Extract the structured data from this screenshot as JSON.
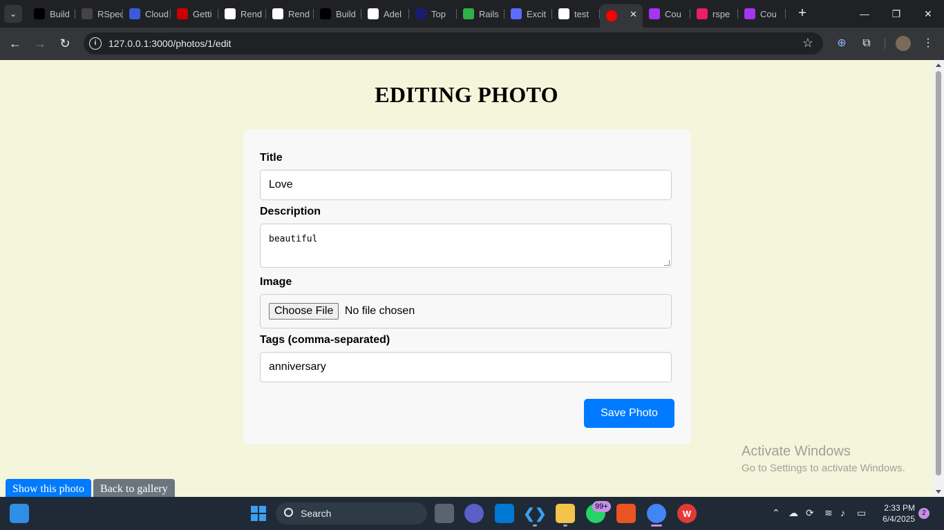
{
  "browser": {
    "tabs": [
      {
        "label": "Build",
        "icon": "medium-icon",
        "color": "#000000"
      },
      {
        "label": "RSpec",
        "icon": "rspec-icon",
        "color": "#444444"
      },
      {
        "label": "Cloud",
        "icon": "cloud-icon",
        "color": "#3b5bdb"
      },
      {
        "label": "Getti",
        "icon": "rails-guide-icon",
        "color": "#cc0000"
      },
      {
        "label": "Rend",
        "icon": "render-icon",
        "color": "#ffffff"
      },
      {
        "label": "Rend",
        "icon": "render-icon",
        "color": "#ffffff"
      },
      {
        "label": "Build",
        "icon": "medium-icon",
        "color": "#000000"
      },
      {
        "label": "Adel",
        "icon": "github-icon",
        "color": "#ffffff"
      },
      {
        "label": "Top",
        "icon": "b4a-icon",
        "color": "#1a1a6e"
      },
      {
        "label": "Rails",
        "icon": "rails-icon",
        "color": "#2db24a"
      },
      {
        "label": "Excit",
        "icon": "gear-icon",
        "color": "#5b6cff"
      },
      {
        "label": "test",
        "icon": "google-icon",
        "color": "#ffffff"
      },
      {
        "label": "",
        "icon": "red-dot-icon",
        "color": "#ff0000",
        "active": true
      },
      {
        "label": "Cou",
        "icon": "udemy-icon",
        "color": "#a435f0"
      },
      {
        "label": "rspe",
        "icon": "heart-icon",
        "color": "#e91e63"
      },
      {
        "label": "Cou",
        "icon": "udemy-icon",
        "color": "#a435f0"
      }
    ],
    "url_host": "127.0.0.1",
    "url_path": ":3000/photos/1/edit"
  },
  "page": {
    "title": "EDITING PHOTO",
    "form": {
      "title_label": "Title",
      "title_value": "Love",
      "description_label": "Description",
      "description_value": "beautiful",
      "image_label": "Image",
      "file_button": "Choose File",
      "file_status": "No file chosen",
      "tags_label": "Tags (comma-separated)",
      "tags_value": "anniversary",
      "submit_label": "Save Photo"
    },
    "show_link": "Show this photo",
    "back_link": "Back to gallery",
    "accent_color": "#007bff",
    "background_color": "#f5f5dc"
  },
  "watermark": {
    "line1": "Activate Windows",
    "line2": "Go to Settings to activate Windows."
  },
  "taskbar": {
    "search_label": "Search",
    "whatsapp_badge": "99+",
    "time": "2:33 PM",
    "date": "6/4/2025",
    "notification_count": "2"
  }
}
